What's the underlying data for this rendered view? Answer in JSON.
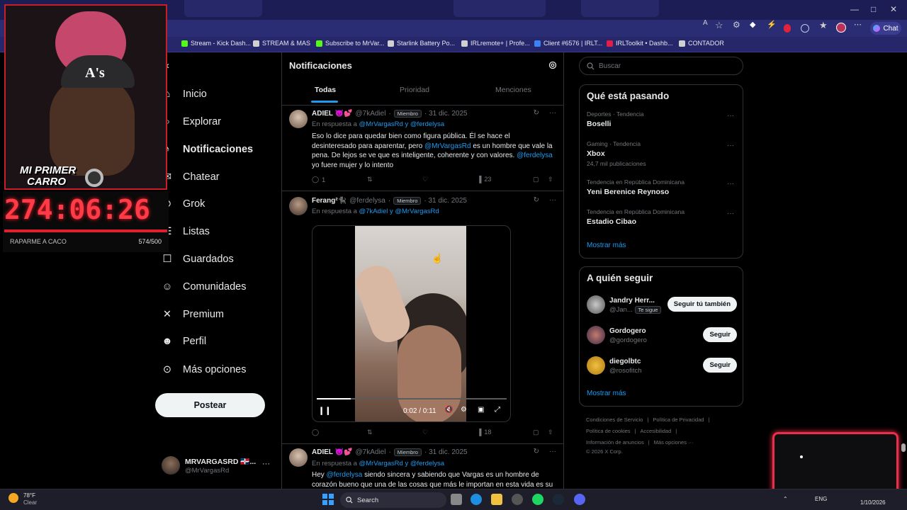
{
  "browser": {
    "chat_label": "Chat",
    "bookmarks": [
      {
        "label": "Stream - Kick Dash...",
        "color": "#53fc18"
      },
      {
        "label": "STREAM & MAS",
        "color": "#d0d0d0"
      },
      {
        "label": "Subscribe to MrVar...",
        "color": "#53fc18"
      },
      {
        "label": "Starlink Battery Po...",
        "color": "#d0d0d0"
      },
      {
        "label": "IRLremote+ | Profe...",
        "color": "#d0d0d0"
      },
      {
        "label": "Client #6576 | IRLT...",
        "color": "#3b82f6"
      },
      {
        "label": "IRLToolkit • Dashb...",
        "color": "#e11d48"
      },
      {
        "label": "CONTADOR",
        "color": "#d0d0d0"
      }
    ]
  },
  "nav": {
    "items": [
      {
        "label": "Inicio",
        "icon": "home-icon"
      },
      {
        "label": "Explorar",
        "icon": "search-icon"
      },
      {
        "label": "Notificaciones",
        "icon": "bell-icon"
      },
      {
        "label": "Chatear",
        "icon": "mail-icon"
      },
      {
        "label": "Grok",
        "icon": "grok-icon"
      },
      {
        "label": "Listas",
        "icon": "list-icon"
      },
      {
        "label": "Guardados",
        "icon": "bookmark-icon"
      },
      {
        "label": "Comunidades",
        "icon": "communities-icon"
      },
      {
        "label": "Premium",
        "icon": "x-logo-icon"
      },
      {
        "label": "Perfil",
        "icon": "profile-icon"
      },
      {
        "label": "Más opciones",
        "icon": "more-circle-icon"
      }
    ],
    "post_label": "Postear",
    "account": {
      "name": "MRVARGASRD 🇩🇴...",
      "handle": "@MrVargasRd"
    }
  },
  "center": {
    "title": "Notificaciones",
    "tabs": [
      "Todas",
      "Prioridad",
      "Menciones"
    ],
    "tweets": [
      {
        "name": "ADIEL 😈💕",
        "handle": "@7kAdiel",
        "badge": "Miembro",
        "date": "· 31 dic. 2025",
        "reply_prefix": "En respuesta a",
        "reply_targets": "@MrVargasRd y @ferdelysa",
        "body_parts": [
          "Eso lo dice para quedar bien como figura pública. Él se hace el desinteresado para aparentar, pero ",
          "@MrVargasRd",
          " es un hombre que vale la pena. De lejos se ve que es inteligente, coherente y con valores. ",
          "@ferdelysa",
          " yo fuere mujer y lo intento"
        ],
        "replies": "1",
        "views": "23"
      },
      {
        "name": "Ferang²🐈‍⬛",
        "handle": "@ferdelysa",
        "badge": "Miembro",
        "date": "· 31 dic. 2025",
        "reply_prefix": "En respuesta a",
        "reply_targets": "@7kAdiel y @MrVargasRd",
        "video_time": "0:02 / 0:11",
        "video_progress": 0.18,
        "views": "18"
      },
      {
        "name": "ADIEL 😈💕",
        "handle": "@7kAdiel",
        "badge": "Miembro",
        "date": "· 31 dic. 2025",
        "reply_prefix": "En respuesta a",
        "reply_targets": "@MrVargasRd y @ferdelysa",
        "body_parts": [
          "Hey ",
          "@ferdelysa",
          " siendo sincera y sabiendo que Vargas es un hombre de corazón bueno que una de las cosas que más le importan en esta vida es su"
        ]
      }
    ]
  },
  "right": {
    "search_placeholder": "Buscar",
    "trends_title": "Qué está pasando",
    "trends": [
      {
        "category": "Deportes · Tendencia",
        "name": "Boselli",
        "count": ""
      },
      {
        "category": "Gaming · Tendencia",
        "name": "Xbox",
        "count": "24,7 mil publicaciones"
      },
      {
        "category": "Tendencia en República Dominicana",
        "name": "Yeni Berenice Reynoso",
        "count": ""
      },
      {
        "category": "Tendencia en República Dominicana",
        "name": "Estadio Cibao",
        "count": ""
      }
    ],
    "show_more": "Mostrar más",
    "follow_title": "A quién seguir",
    "follow": [
      {
        "name": "Jandry Herr...",
        "handle": "@Jan...",
        "extra": "Te sigue",
        "button": "Seguir tú también"
      },
      {
        "name": "Gordogero",
        "handle": "@gordogero",
        "extra": "",
        "button": "Seguir"
      },
      {
        "name": "diegolbtc",
        "handle": "@rosofitch",
        "extra": "",
        "button": "Seguir"
      }
    ],
    "footer": [
      "Condiciones de Servicio",
      "|",
      "Política de Privacidad",
      "|",
      "Política de cookies",
      "|",
      "Accesibilidad",
      "|",
      "Información de anuncios",
      "|",
      "Más opciones ···",
      "© 2026 X Corp."
    ]
  },
  "overlay": {
    "cam_text_1": "MI PRIMER",
    "cam_text_2": "CARRO",
    "timer": "274:06:26",
    "goal_label": "RAPARME A CACO",
    "goal_count": "574/500",
    "goal_progress": 1.0
  },
  "taskbar": {
    "weather_temp": "78°F",
    "weather_desc": "Clear",
    "search_label": "Search",
    "lang": "ENG",
    "date": "1/10/2026"
  },
  "colors": {
    "accent": "#1d9bf0",
    "timer": "#ff3b48",
    "overlay_border": "#e8304a"
  }
}
